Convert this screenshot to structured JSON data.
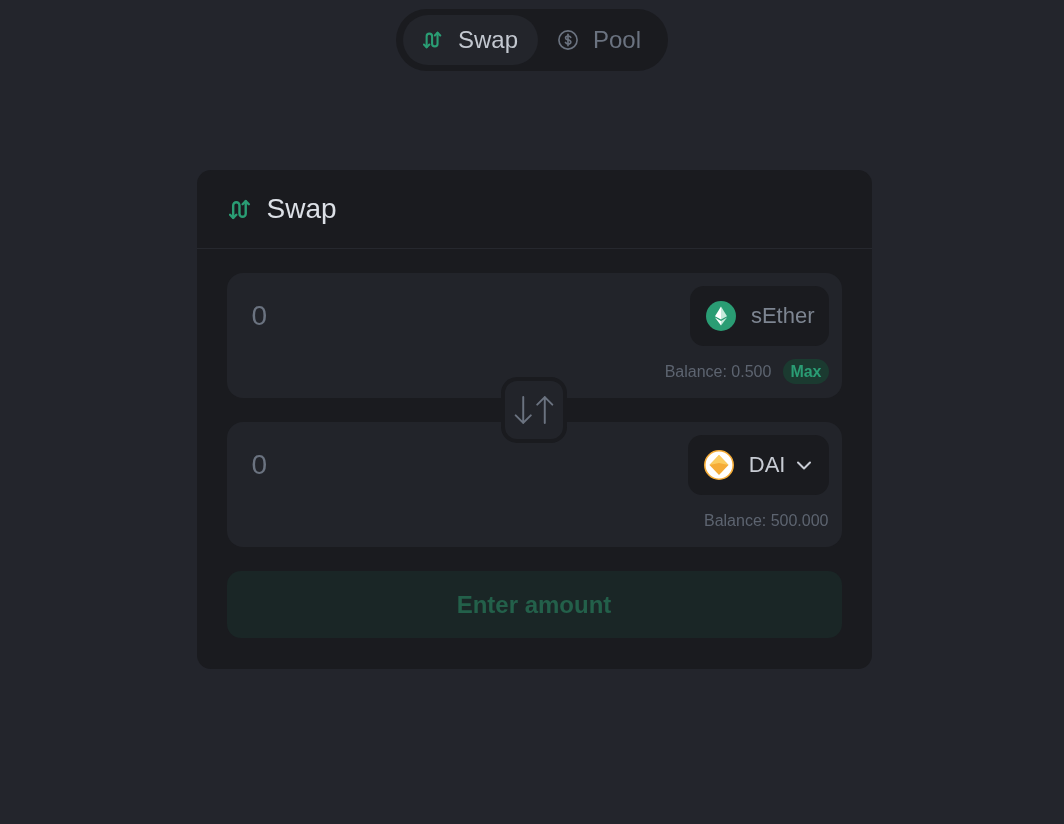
{
  "nav": {
    "tabs": [
      {
        "label": "Swap",
        "kind": "swap",
        "selected": true
      },
      {
        "label": "Pool",
        "kind": "pool",
        "selected": false
      }
    ]
  },
  "card": {
    "title": "Swap",
    "kind": "swap"
  },
  "inputs": [
    {
      "placeholder": "0",
      "token": {
        "symbol": "sEther",
        "kind": "ether",
        "disabled": true
      },
      "balance": "Balance: 0.500",
      "max": "Max"
    },
    {
      "placeholder": "0",
      "token": {
        "symbol": "DAI",
        "kind": "dai",
        "disabled": false
      },
      "balance": "Balance: 500.000"
    }
  ],
  "submit": {
    "label": "Enter amount",
    "disabled": true
  }
}
